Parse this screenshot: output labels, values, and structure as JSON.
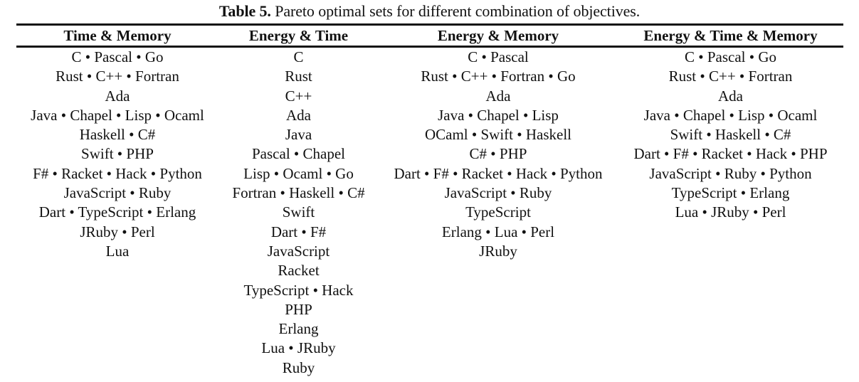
{
  "caption": {
    "label": "Table 5.",
    "text": " Pareto optimal sets for different combination of objectives."
  },
  "table": {
    "separator": "•",
    "columns": [
      {
        "header": "Time & Memory",
        "rows": [
          "C • Pascal • Go",
          "Rust • C++ • Fortran",
          "Ada",
          "Java • Chapel • Lisp • Ocaml",
          "Haskell • C#",
          "Swift • PHP",
          "F# • Racket • Hack • Python",
          "JavaScript • Ruby",
          "Dart • TypeScript • Erlang",
          "JRuby • Perl",
          "Lua"
        ]
      },
      {
        "header": "Energy & Time",
        "rows": [
          "C",
          "Rust",
          "C++",
          "Ada",
          "Java",
          "Pascal • Chapel",
          "Lisp • Ocaml • Go",
          "Fortran • Haskell • C#",
          "Swift",
          "Dart • F#",
          "JavaScript",
          "Racket",
          "TypeScript • Hack",
          "PHP",
          "Erlang",
          "Lua • JRuby",
          "Ruby"
        ]
      },
      {
        "header": "Energy & Memory",
        "rows": [
          "C • Pascal",
          "Rust • C++ • Fortran • Go",
          "Ada",
          "Java • Chapel • Lisp",
          "OCaml • Swift • Haskell",
          "C# • PHP",
          "Dart • F# • Racket • Hack • Python",
          "JavaScript • Ruby",
          "TypeScript",
          "Erlang • Lua • Perl",
          "JRuby"
        ]
      },
      {
        "header": "Energy & Time & Memory",
        "rows": [
          "C • Pascal • Go",
          "Rust • C++ • Fortran",
          "Ada",
          "Java • Chapel • Lisp • Ocaml",
          "Swift • Haskell • C#",
          "Dart • F# • Racket • Hack • PHP",
          "JavaScript • Ruby • Python",
          "TypeScript • Erlang",
          "Lua • JRuby • Perl"
        ]
      }
    ]
  }
}
